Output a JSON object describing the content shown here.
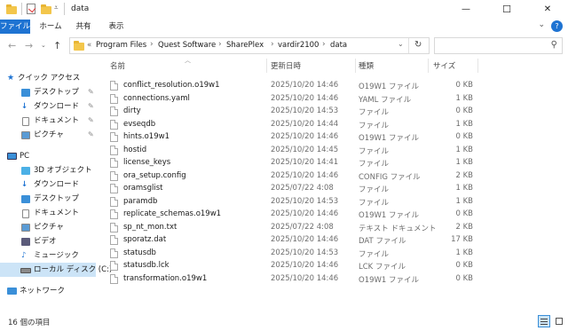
{
  "window": {
    "title": "data",
    "minimize": "—",
    "maximize": "☐",
    "close": "✕"
  },
  "ribbon": {
    "tabs": [
      "ファイル",
      "ホーム",
      "共有",
      "表示"
    ],
    "active_color": "#1e73d2"
  },
  "address": {
    "crumbs": [
      "Program Files",
      "Quest Software",
      "SharePlex",
      "vardir2100",
      "data"
    ],
    "prefix": "«"
  },
  "search": {
    "placeholder": ""
  },
  "sidebar": {
    "quick_access": "クイック アクセス",
    "quick_items": [
      "デスクトップ",
      "ダウンロード",
      "ドキュメント",
      "ピクチャ"
    ],
    "pc": "PC",
    "pc_items": [
      "3D オブジェクト",
      "ダウンロード",
      "デスクトップ",
      "ドキュメント",
      "ピクチャ",
      "ビデオ",
      "ミュージック",
      "ローカル ディスク (C:)"
    ],
    "network": "ネットワーク"
  },
  "columns": {
    "name": "名前",
    "date": "更新日時",
    "type": "種類",
    "size": "サイズ"
  },
  "files": [
    {
      "name": "conflict_resolution.o19w1",
      "date": "2025/10/20 14:46",
      "type": "O19W1 ファイル",
      "size": "0 KB"
    },
    {
      "name": "connections.yaml",
      "date": "2025/10/20 14:46",
      "type": "YAML ファイル",
      "size": "1 KB"
    },
    {
      "name": "dirty",
      "date": "2025/10/20 14:53",
      "type": "ファイル",
      "size": "0 KB"
    },
    {
      "name": "evseqdb",
      "date": "2025/10/20 14:44",
      "type": "ファイル",
      "size": "1 KB"
    },
    {
      "name": "hints.o19w1",
      "date": "2025/10/20 14:46",
      "type": "O19W1 ファイル",
      "size": "0 KB"
    },
    {
      "name": "hostid",
      "date": "2025/10/20 14:45",
      "type": "ファイル",
      "size": "1 KB"
    },
    {
      "name": "license_keys",
      "date": "2025/10/20 14:41",
      "type": "ファイル",
      "size": "1 KB"
    },
    {
      "name": "ora_setup.config",
      "date": "2025/10/20 14:46",
      "type": "CONFIG ファイル",
      "size": "2 KB"
    },
    {
      "name": "oramsglist",
      "date": "2025/07/22 4:08",
      "type": "ファイル",
      "size": "1 KB"
    },
    {
      "name": "paramdb",
      "date": "2025/10/20 14:53",
      "type": "ファイル",
      "size": "1 KB"
    },
    {
      "name": "replicate_schemas.o19w1",
      "date": "2025/10/20 14:46",
      "type": "O19W1 ファイル",
      "size": "0 KB"
    },
    {
      "name": "sp_nt_mon.txt",
      "date": "2025/07/22 4:08",
      "type": "テキスト ドキュメント",
      "size": "2 KB"
    },
    {
      "name": "sporatz.dat",
      "date": "2025/10/20 14:46",
      "type": "DAT ファイル",
      "size": "17 KB"
    },
    {
      "name": "statusdb",
      "date": "2025/10/20 14:53",
      "type": "ファイル",
      "size": "1 KB"
    },
    {
      "name": "statusdb.lck",
      "date": "2025/10/20 14:46",
      "type": "LCK ファイル",
      "size": "0 KB"
    },
    {
      "name": "transformation.o19w1",
      "date": "2025/10/20 14:46",
      "type": "O19W1 ファイル",
      "size": "0 KB"
    }
  ],
  "status": {
    "count": "16 個の項目"
  }
}
